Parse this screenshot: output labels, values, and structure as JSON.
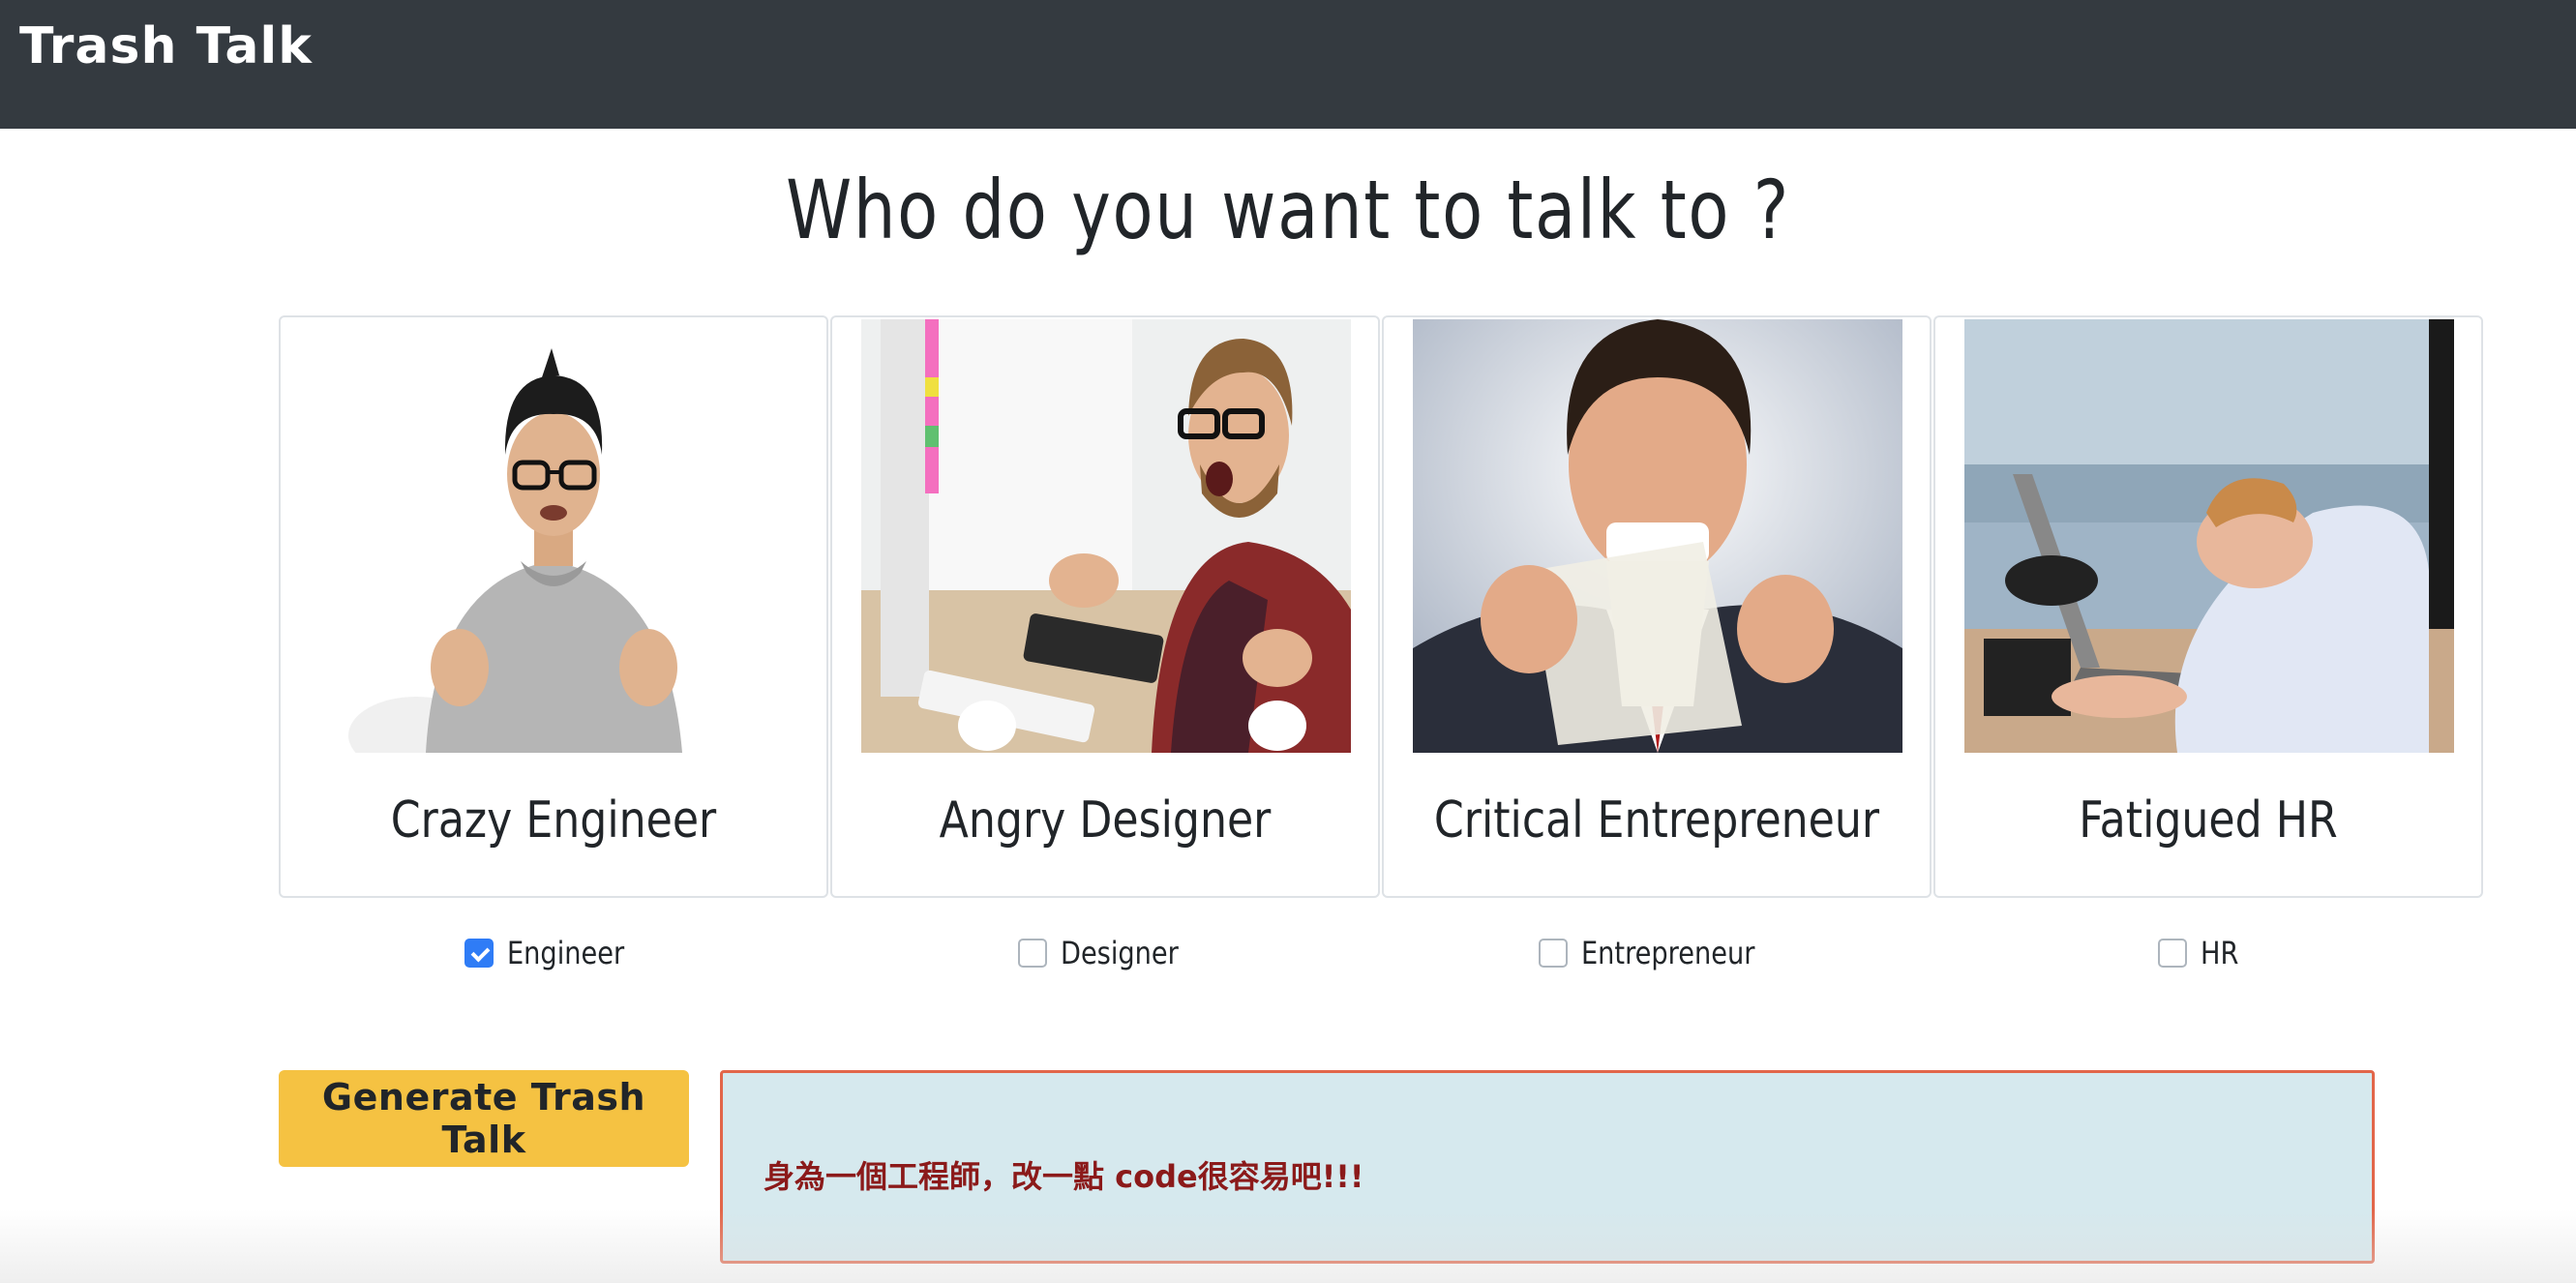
{
  "navbar": {
    "brand": "Trash Talk"
  },
  "heading": "Who do you want to talk to ?",
  "cards": [
    {
      "title": "Crazy Engineer"
    },
    {
      "title": "Angry Designer"
    },
    {
      "title": "Critical Entrepreneur"
    },
    {
      "title": "Fatigued HR"
    }
  ],
  "options": [
    {
      "label": "Engineer",
      "checked": true
    },
    {
      "label": "Designer",
      "checked": false
    },
    {
      "label": "Entrepreneur",
      "checked": false
    },
    {
      "label": "HR",
      "checked": false
    }
  ],
  "generate_button": "Generate Trash Talk",
  "result_text": "身為一個工程師，改一點 code很容易吧!!!",
  "colors": {
    "navbar": "#343a40",
    "button": "#f5c242",
    "result_bg": "#d6e9ee",
    "result_border": "#e2664a",
    "result_text": "#8b1a1a",
    "checkbox_checked": "#2f7cf6"
  }
}
